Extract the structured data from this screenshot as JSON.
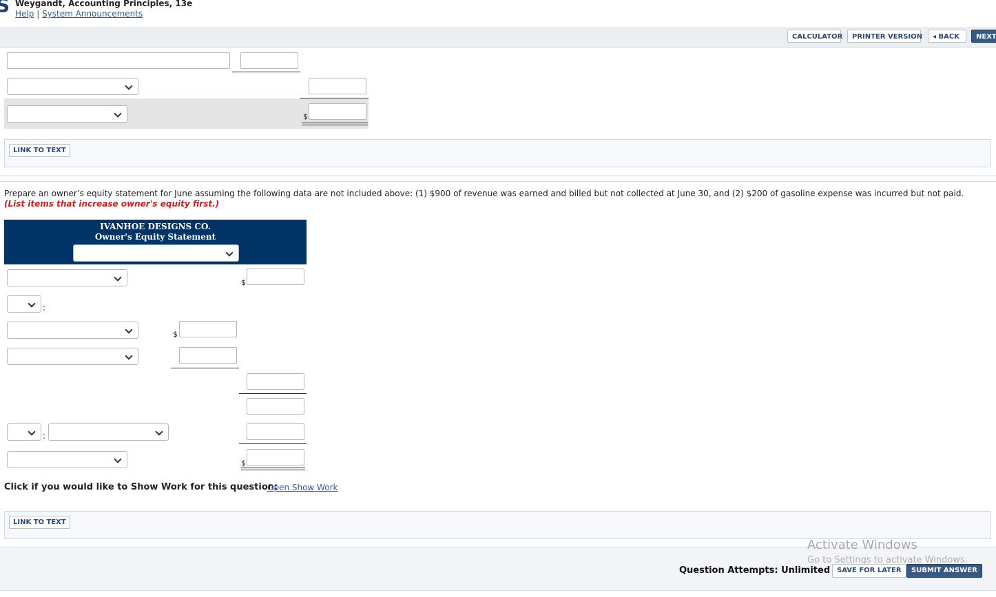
{
  "header": {
    "book_title": "Weygandt, Accounting Principles, 13e",
    "help_link": "Help",
    "divider": "|",
    "announcements_link": "System Announcements"
  },
  "toolbar": {
    "calculator": "CALCULATOR",
    "printer_version": "PRINTER VERSION",
    "back": "◂ BACK",
    "next": "NEXT"
  },
  "top_section": {
    "currency_symbol": "$",
    "link_to_text": "LINK TO TEXT"
  },
  "question": {
    "instructions": "Prepare an owner’s equity statement for June assuming the following data are not included above: (1) $900 of revenue was earned and billed but not collected at June 30, and (2) $200 of gasoline expense was incurred but not paid.",
    "emphasis": "(List items that increase owner's equity first.)"
  },
  "statement": {
    "company": "IVANHOE DESIGNS CO.",
    "title": "Owner's Equity Statement",
    "currency_symbol": "$",
    "colon": ":"
  },
  "show_work": {
    "prompt": "Click if you would like to Show Work for this question:",
    "link": "Open Show Work"
  },
  "bottom_link_to_text": "LINK TO TEXT",
  "footer": {
    "attempts": "Question Attempts: Unlimited",
    "save_for_later": "SAVE FOR LATER",
    "submit_answer": "SUBMIT ANSWER"
  },
  "watermark": {
    "line1": "Activate Windows",
    "line2": "Go to Settings to activate Windows."
  },
  "colors": {
    "navy_header": "#003366",
    "button_dark": "#365a85",
    "emphasis_red": "#d81919",
    "link_blue": "#2a5ea8"
  }
}
